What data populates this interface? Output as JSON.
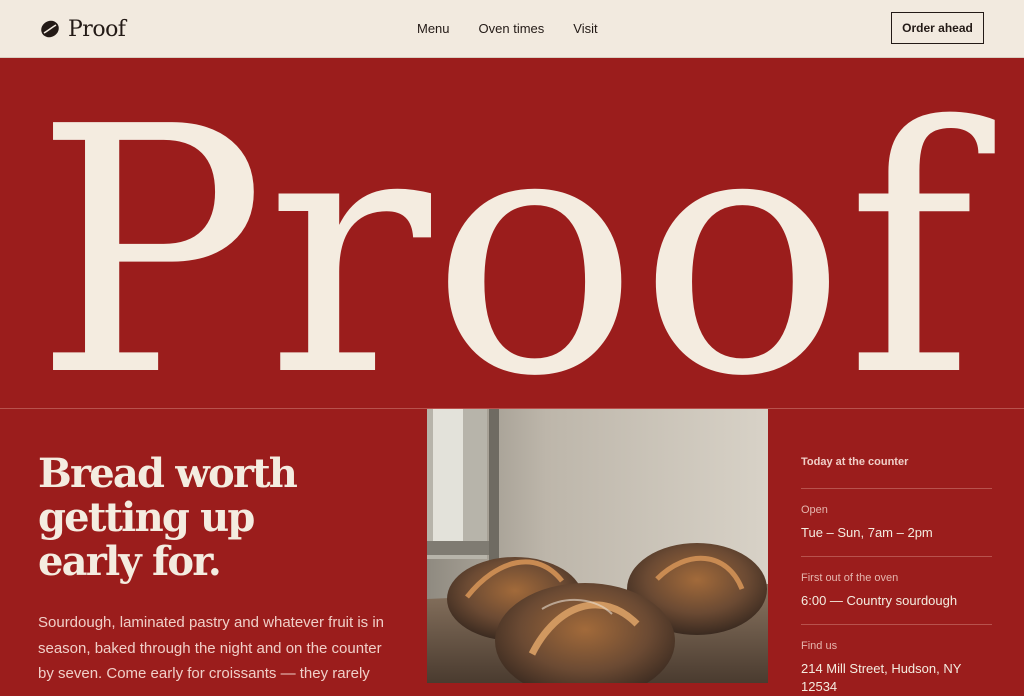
{
  "brand": {
    "name": "Proof",
    "icon": "coffee-bean-icon"
  },
  "nav": {
    "links": [
      "Menu",
      "Oven times",
      "Visit"
    ],
    "cta": "Order ahead"
  },
  "hero": {
    "wordmark": "Proof"
  },
  "intro": {
    "heading_lines": [
      "Bread worth",
      "getting up",
      "early for."
    ],
    "body": "Sourdough, laminated pastry and whatever fruit is in season, baked through the night and on the counter by seven. Come early for croissants — they rarely"
  },
  "counter": {
    "title": "Today at the counter",
    "items": [
      {
        "label": "Open",
        "value": "Tue – Sun, 7am – 2pm"
      },
      {
        "label": "First out of the oven",
        "value": "6:00 — Country sourdough"
      },
      {
        "label": "Find us",
        "value": "214 Mill Street, Hudson, NY 12534"
      }
    ]
  },
  "colors": {
    "brand_red": "#9b1d1c",
    "cream": "#f2eadf",
    "ink": "#231a16"
  }
}
